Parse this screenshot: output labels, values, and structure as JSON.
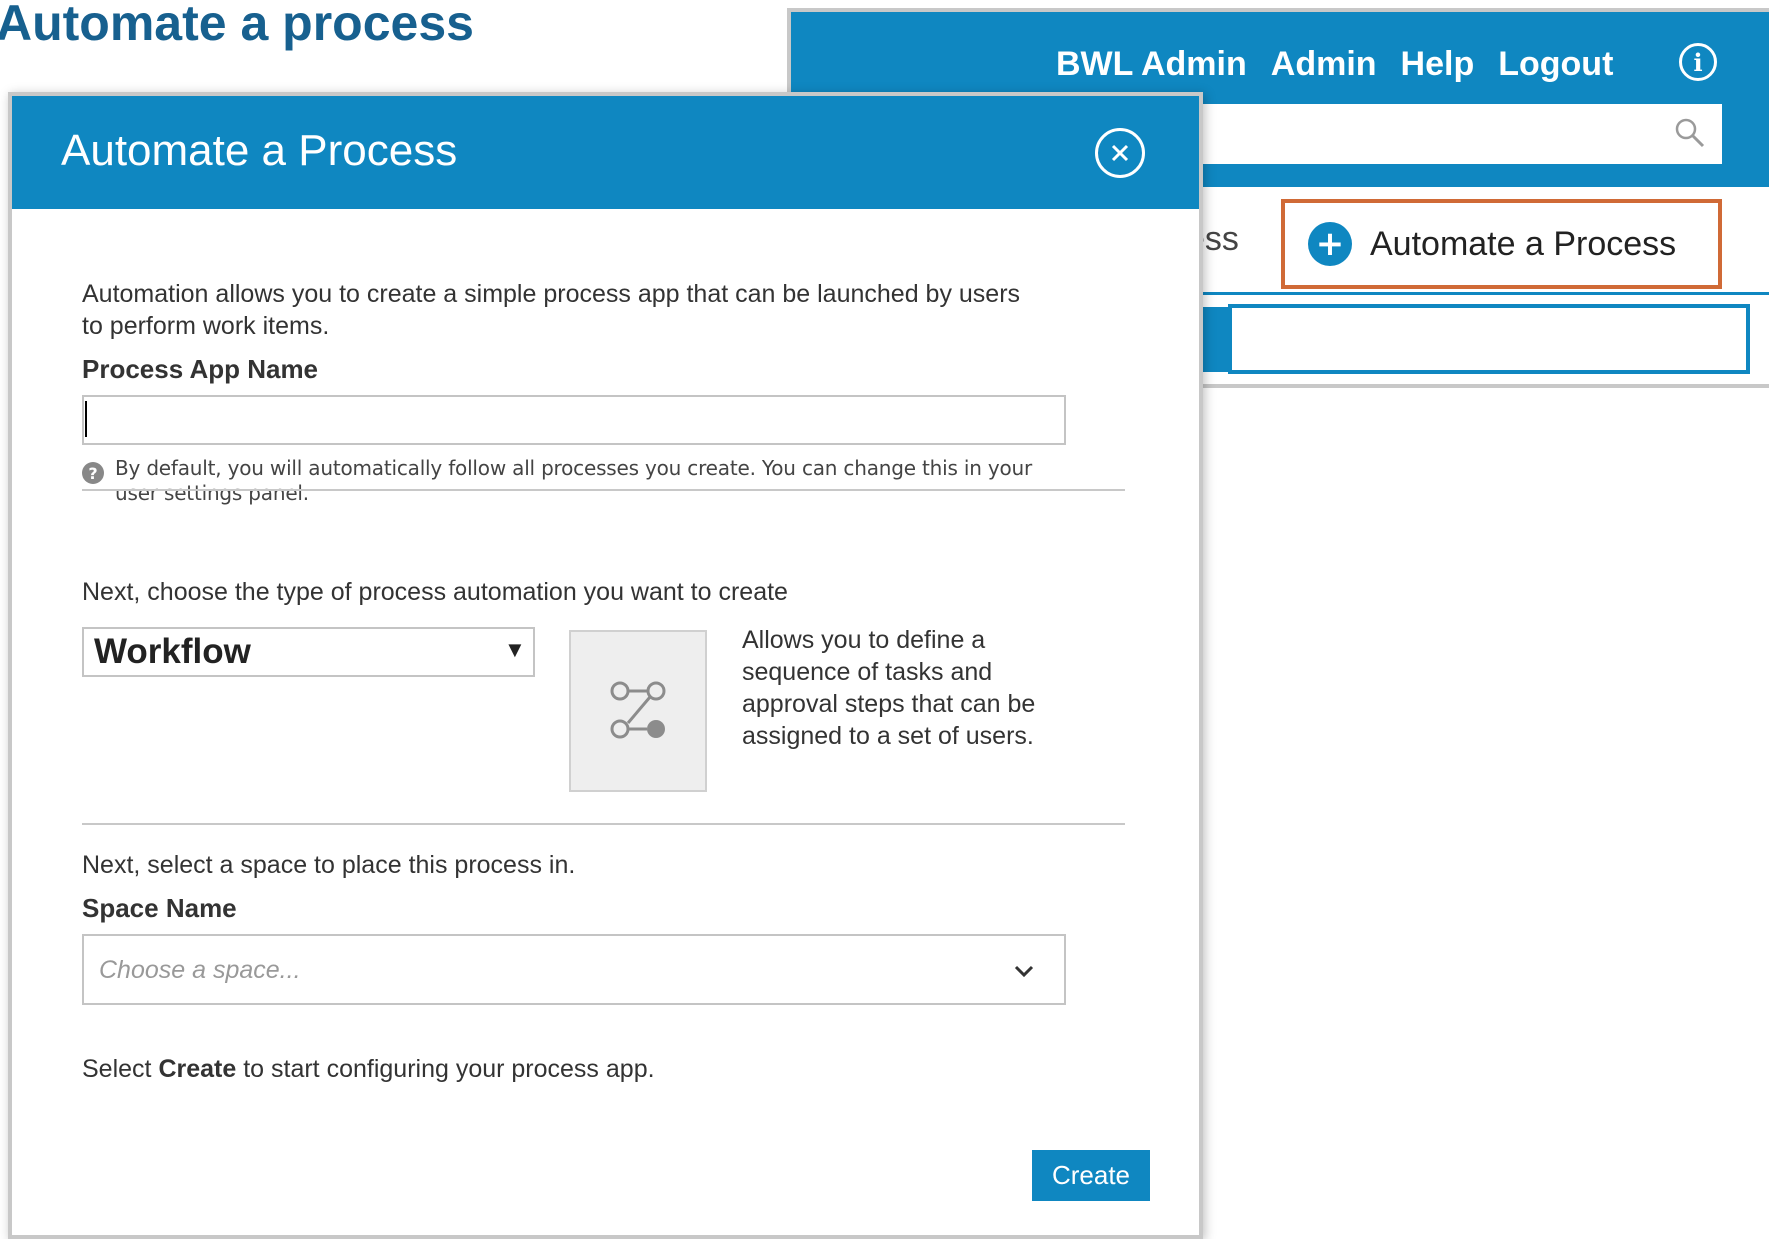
{
  "page": {
    "heading": "Automate a process"
  },
  "background_app": {
    "nav": {
      "user": "BWL Admin",
      "admin": "Admin",
      "help": "Help",
      "logout": "Logout"
    },
    "partial_tab": "ess",
    "automate_button": "Automate a Process",
    "colors": {
      "bar": "#0f87c1",
      "highlight": "#d06a36"
    }
  },
  "modal": {
    "title": "Automate a Process",
    "intro_line1": "Automation allows you to create a simple process app that can be launched by users",
    "intro_line2": "to perform work items.",
    "app_name_label": "Process App Name",
    "app_name_value": "",
    "help_line1": "By default, you will automatically follow all processes you create. You can change this in your",
    "help_line2": "user settings panel.",
    "type_prompt": "Next, choose the type of process automation you want to create",
    "type_selected": "Workflow",
    "type_description": [
      "Allows you to define a",
      "sequence of tasks and",
      "approval steps that can be",
      "assigned to a set of users."
    ],
    "space_prompt": "Next, select a space to place this process in.",
    "space_label": "Space Name",
    "space_placeholder": "Choose a space...",
    "final_prefix": "Select ",
    "final_bold": "Create",
    "final_suffix": " to start configuring your process app.",
    "create_button": "Create"
  }
}
